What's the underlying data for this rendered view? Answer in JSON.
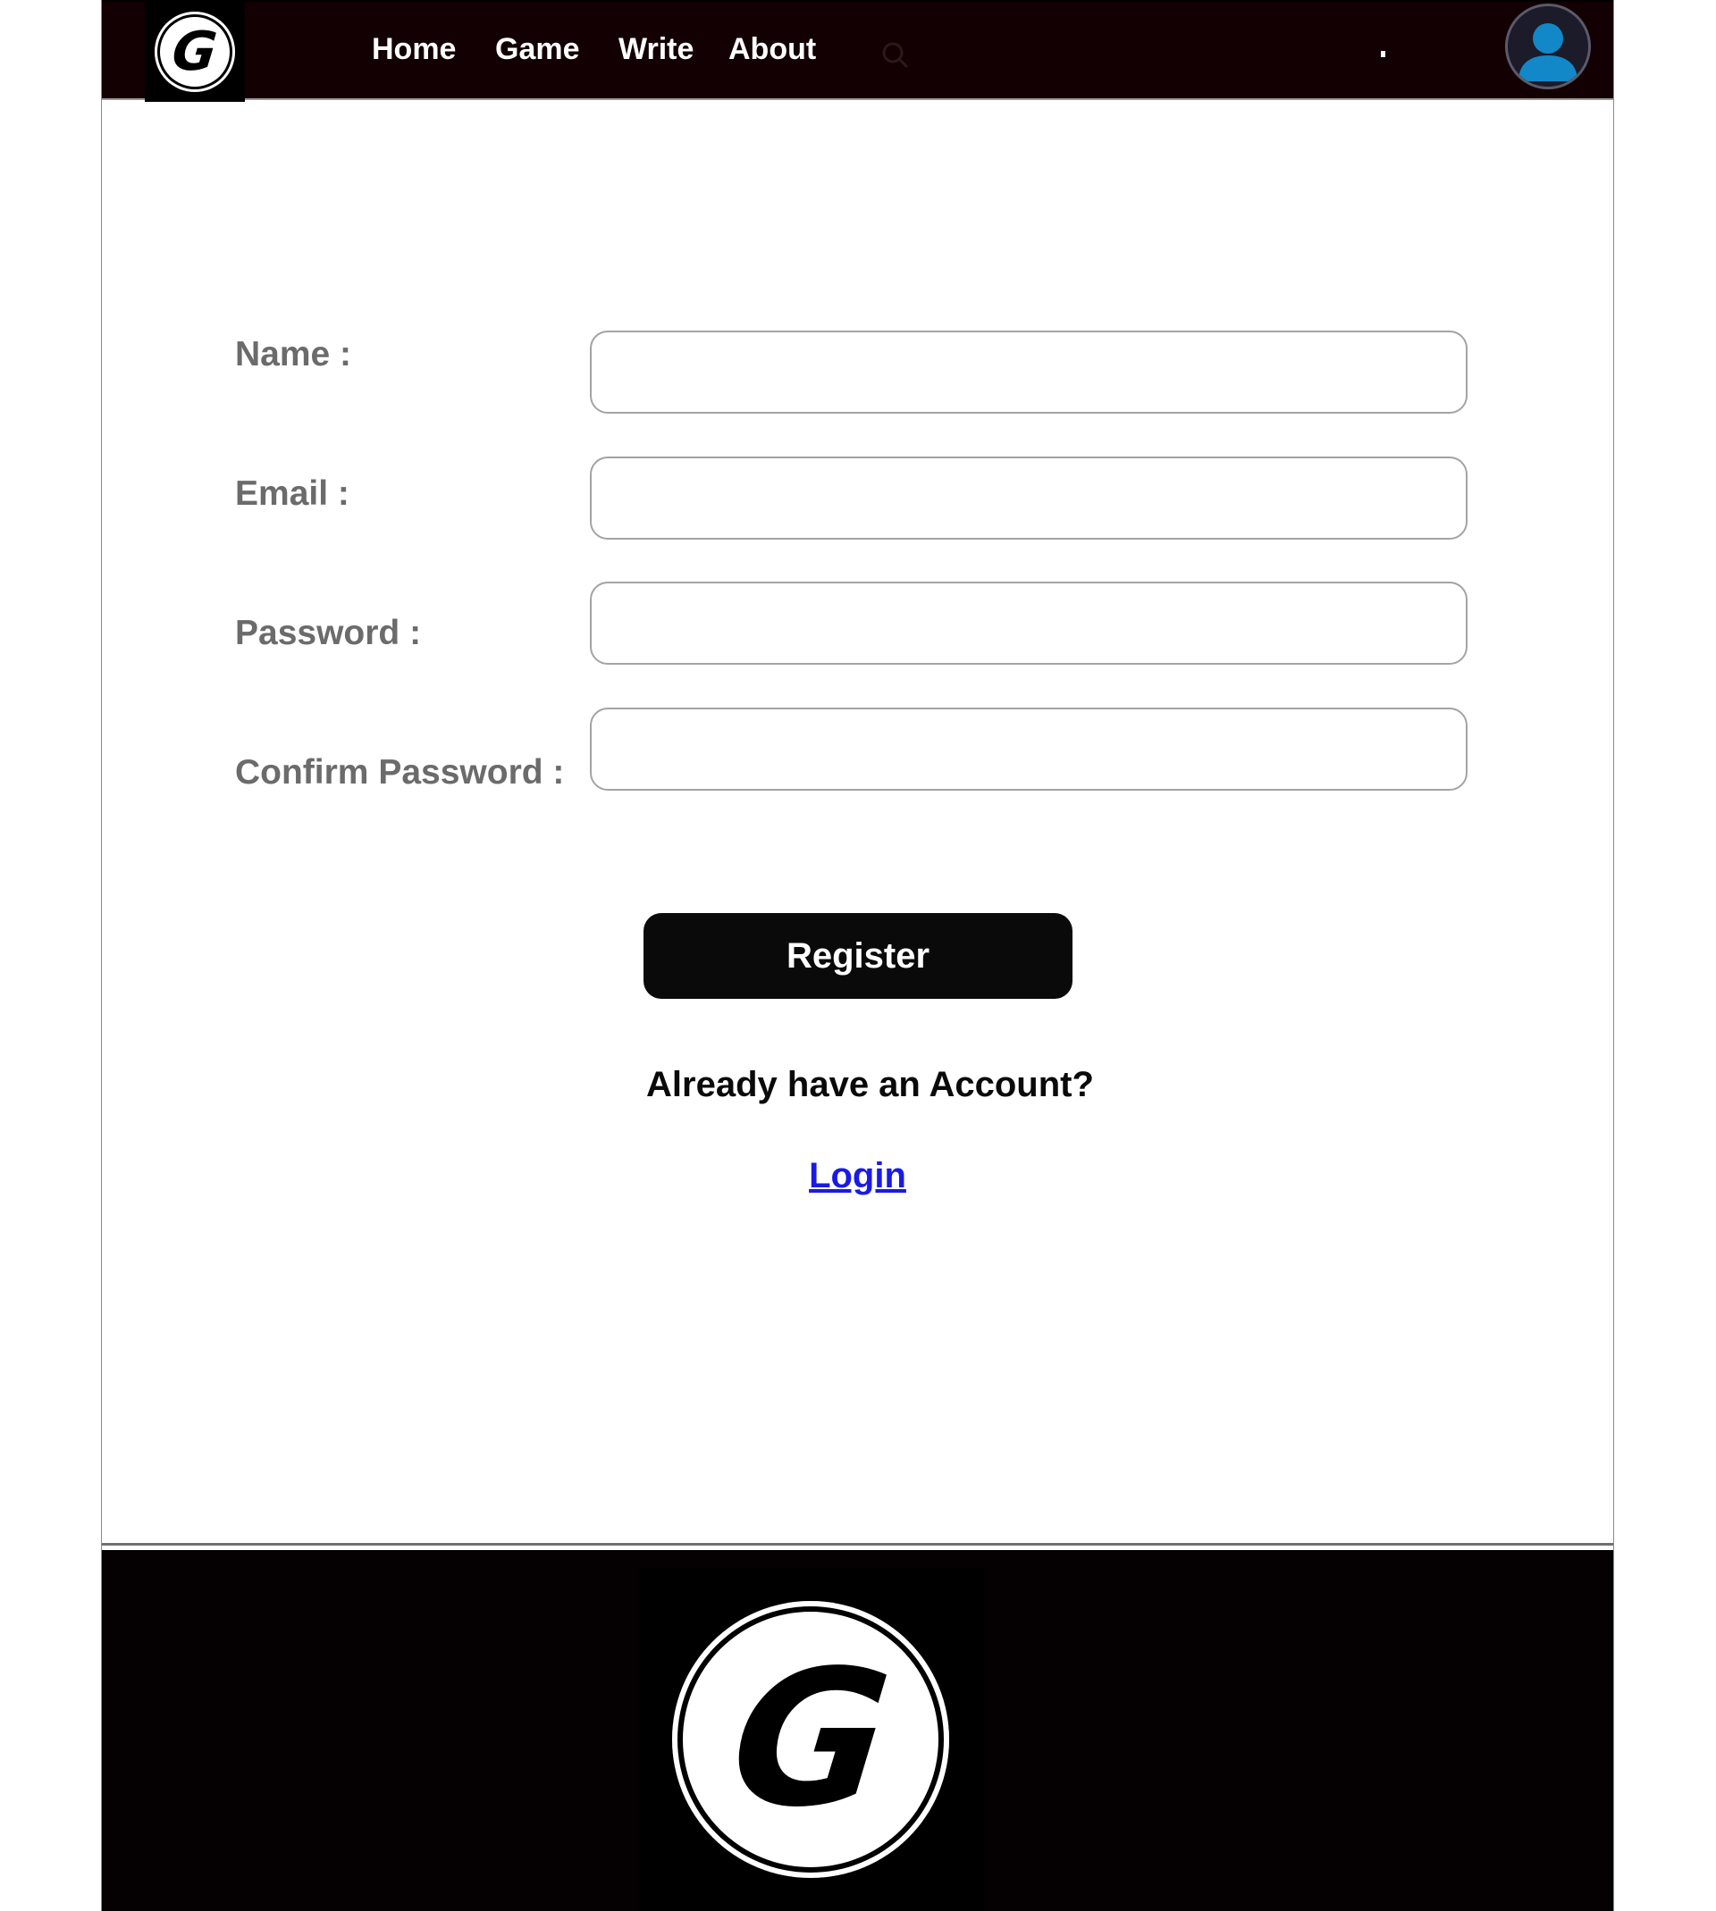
{
  "header": {
    "logo_letter": "G",
    "nav": [
      {
        "label": "Home"
      },
      {
        "label": "Game"
      },
      {
        "label": "Write"
      },
      {
        "label": "About"
      }
    ],
    "icons": {
      "search": "search-icon",
      "avatar": "user-avatar-icon"
    },
    "colors": {
      "bar": "#130002",
      "avatar": "#1288c8"
    }
  },
  "form": {
    "fields": [
      {
        "label": "Name :",
        "value": ""
      },
      {
        "label": "Email :",
        "value": ""
      },
      {
        "label": "Password :",
        "value": ""
      },
      {
        "label": "Confirm Password :",
        "value": ""
      }
    ],
    "register_label": "Register",
    "already_text": "Already have an Account?",
    "login_label": "Login",
    "colors": {
      "label": "#6b6b6b",
      "button": "#0a0a0a",
      "link": "#1a1ae6"
    }
  },
  "footer": {
    "logo_letter": "G"
  }
}
